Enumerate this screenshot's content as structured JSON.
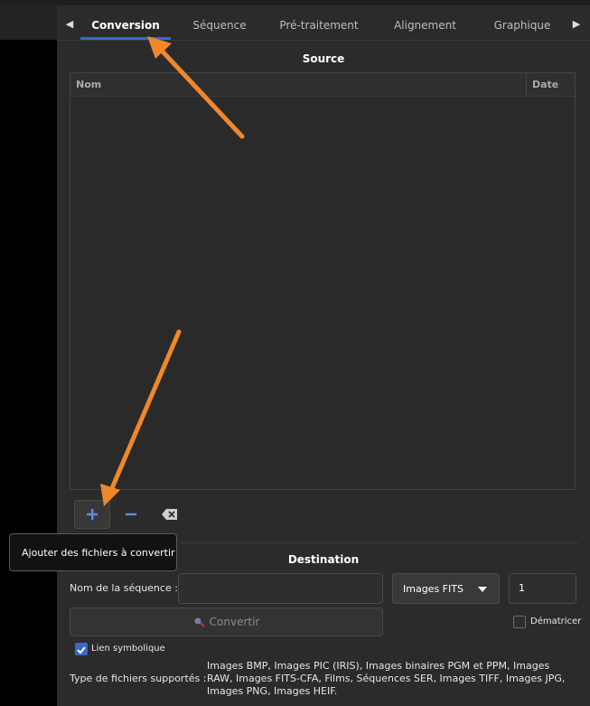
{
  "tabs": {
    "items": [
      {
        "label": "Conversion"
      },
      {
        "label": "Séquence"
      },
      {
        "label": "Pré-traitement"
      },
      {
        "label": "Alignement"
      },
      {
        "label": "Graphique"
      }
    ],
    "active": "Conversion"
  },
  "source": {
    "title": "Source",
    "columns": [
      "Nom",
      "Date"
    ],
    "rows": []
  },
  "tooltip": {
    "text": "Ajouter des fichiers à convertir"
  },
  "destination": {
    "title": "Destination",
    "sequence_name_label": "Nom de la séquence :",
    "sequence_name_value": "",
    "format_selected": "Images FITS",
    "start_index": "1",
    "debayer_label": "Dématricer",
    "debayer_checked": false,
    "convert_label": "Convertir",
    "symlink_label": "Lien symbolique",
    "symlink_checked": true,
    "supported_label": "Type de fichiers supportés :",
    "supported_text": "Images BMP, Images PIC (IRIS), Images binaires PGM et PPM, Images RAW, Images FITS-CFA, Films, Séquences SER, Images TIFF, Images JPG, Images PNG, Images HEIF."
  },
  "colors": {
    "accent": "#3b67c9",
    "annotation_arrow": "#f0872b"
  }
}
